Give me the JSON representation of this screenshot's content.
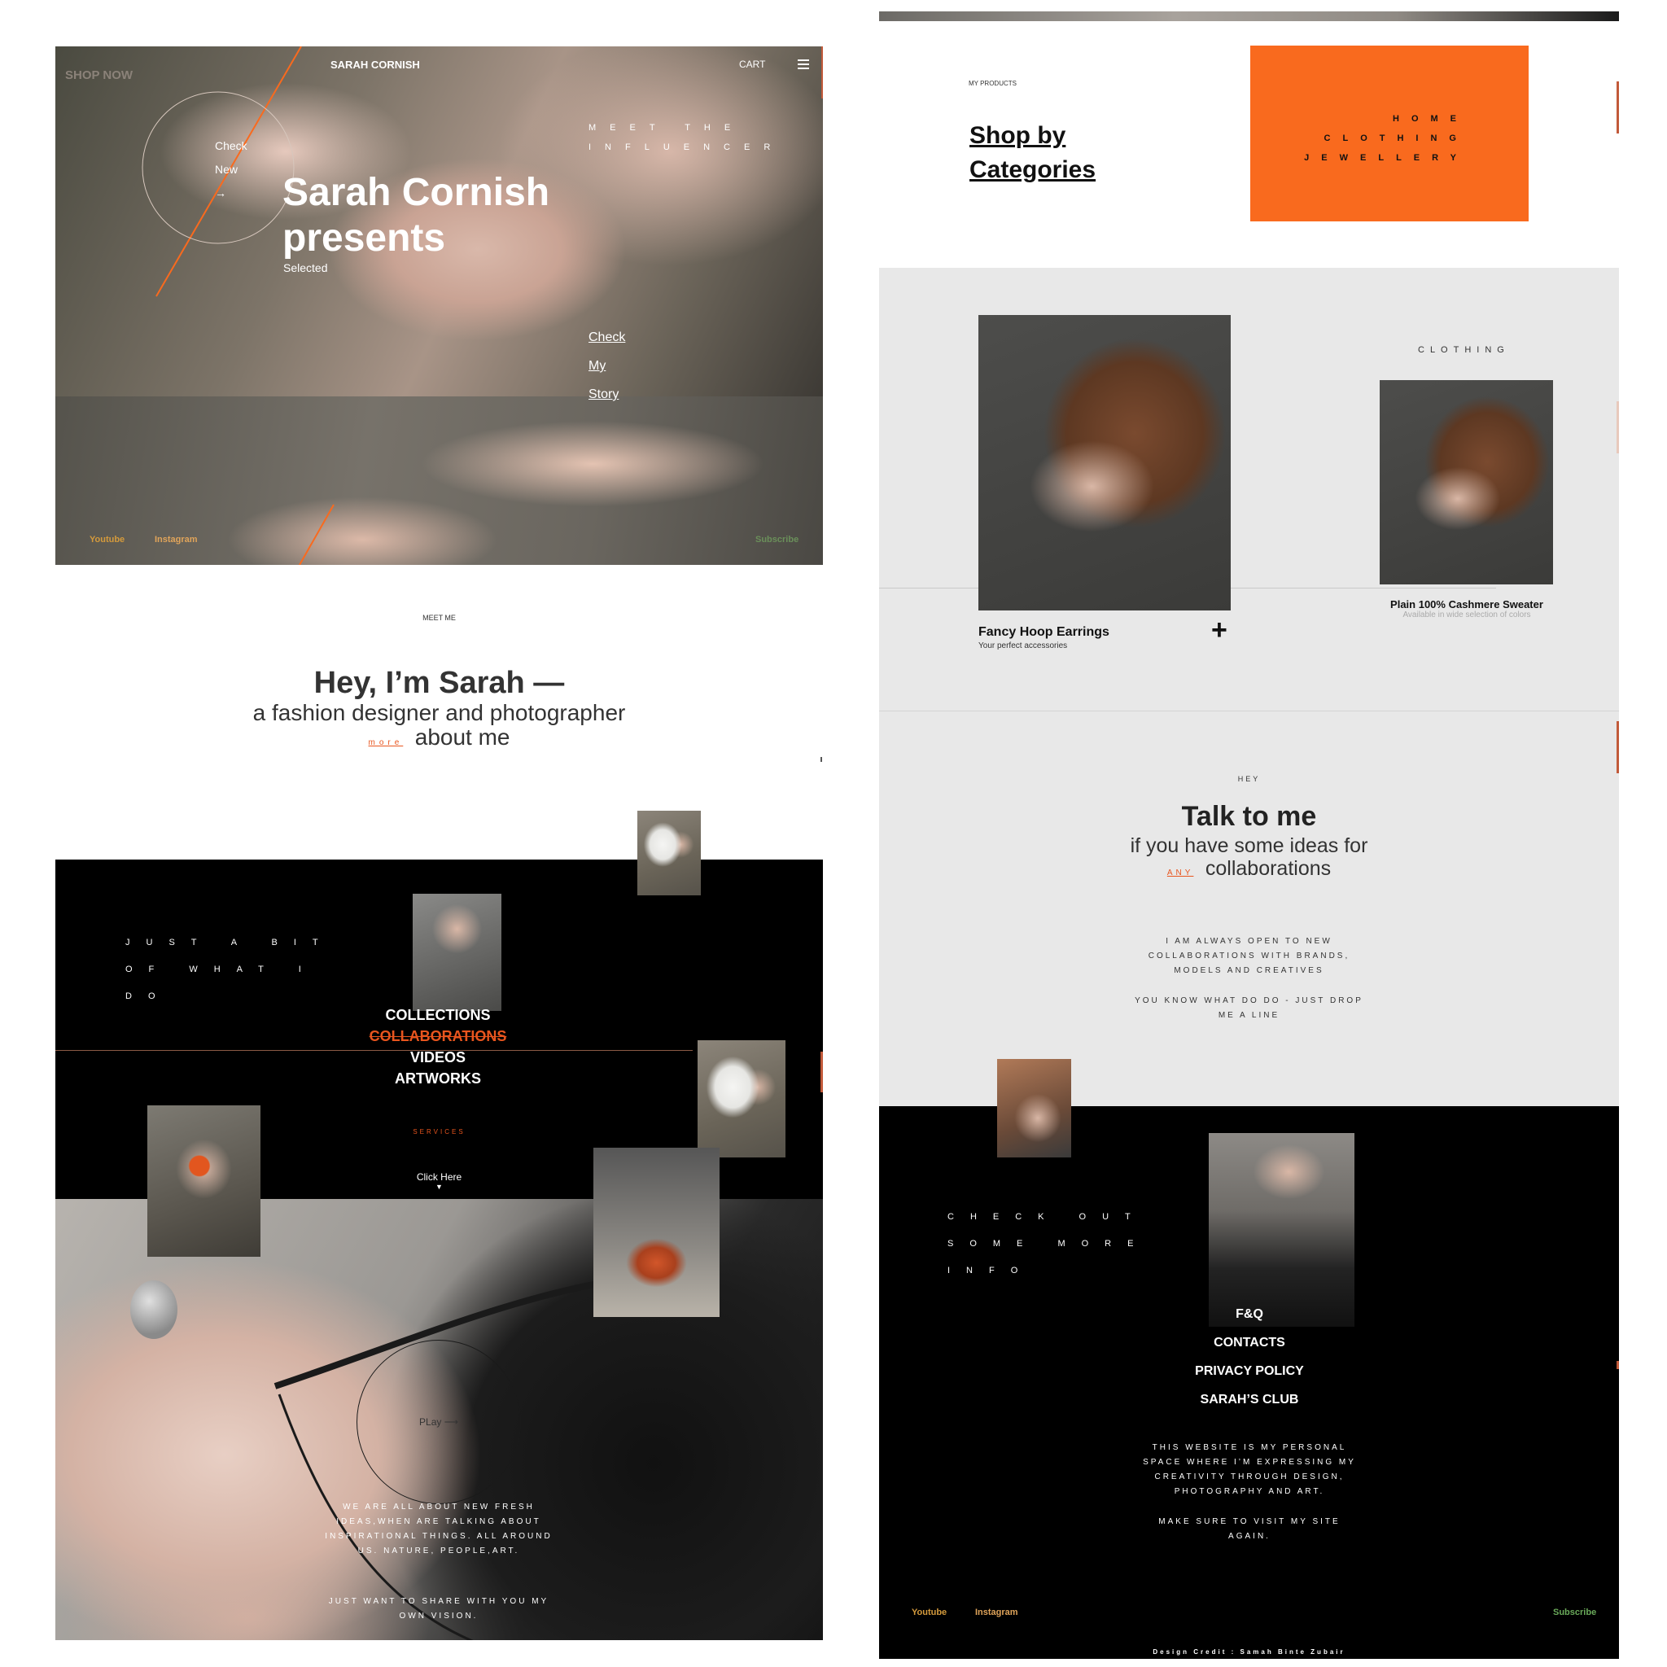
{
  "hero": {
    "shop_now": "SHOP NOW",
    "brand": "SARAH CORNISH",
    "cart": "CART",
    "circle_check": "Check",
    "circle_new": "New",
    "circle_arrow": "→",
    "meet_line1": "MEET THE",
    "meet_line2": "INFLUENCER",
    "title_line1": "Sarah Cornish",
    "title_line2": "presents",
    "selected": "Selected",
    "story_check": "Check",
    "story_my": "My",
    "story_story": "Story",
    "youtube": "Youtube",
    "instagram": "Instagram",
    "subscribe": "Subscribe"
  },
  "meet": {
    "label": "MEET ME",
    "title": "Hey, I’m Sarah —",
    "subtitle": "a fashion designer and photographer",
    "more": "more",
    "about": "about me"
  },
  "work": {
    "side_line1": "JUST A BIT",
    "side_line2": "OF WHAT I",
    "side_line3": "DO",
    "menu": [
      "COLLECTIONS",
      "COLLABORATIONS",
      "VIDEOS",
      "ARTWORKS"
    ],
    "services": "SERVICES",
    "click_here": "Click Here",
    "play": "PLay ⟶",
    "para1": "WE ARE ALL ABOUT NEW FRESH IDEAS,WHEN ARE TALKING ABOUT INSPIRATIONAL THINGS. ALL AROUND US. NATURE, PEOPLE,ART.",
    "para2": "JUST WANT TO SHARE WITH YOU MY OWN VISION."
  },
  "products": {
    "label": "MY PRODUCTS",
    "title_line1": "Shop by",
    "title_line2": "Categories",
    "categories": [
      "HOME",
      "CLOTHING",
      "JEWELLERY"
    ],
    "clothing_label": "CLOTHING",
    "item1_name": "Fancy Hoop Earrings",
    "item1_desc": "Your perfect accessories",
    "plus": "+",
    "item2_name": "Plain 100% Cashmere Sweater",
    "item2_desc": "Available in wide selection of colors"
  },
  "talk": {
    "label": "HEY",
    "title": "Talk to me",
    "line1": "if you have some ideas for",
    "any": "ANY",
    "line2": "collaborations",
    "para1": "I AM ALWAYS OPEN TO NEW COLLABORATIONS WITH BRANDS, MODELS AND CREATIVES",
    "para2": "YOU KNOW WHAT DO DO - JUST DROP ME A LINE"
  },
  "footer": {
    "side_line1": "CHECK OUT",
    "side_line2": "SOME MORE",
    "side_line3": "INFO",
    "links": [
      "F&Q",
      "CONTACTS",
      "PRIVACY POLICY",
      "SARAH’S CLUB"
    ],
    "para1": "THIS WEBSITE IS MY PERSONAL SPACE WHERE I’M EXPRESSING MY CREATIVITY THROUGH DESIGN, PHOTOGRAPHY AND ART.",
    "para2": "MAKE SURE TO VISIT MY SITE AGAIN.",
    "youtube": "Youtube",
    "instagram": "Instagram",
    "subscribe": "Subscribe",
    "credit": "Design Credit : Samah Binte Zubair"
  },
  "colors": {
    "accent": "#f96a1e",
    "dark": "#000000",
    "light_gray": "#e8e8e8"
  }
}
